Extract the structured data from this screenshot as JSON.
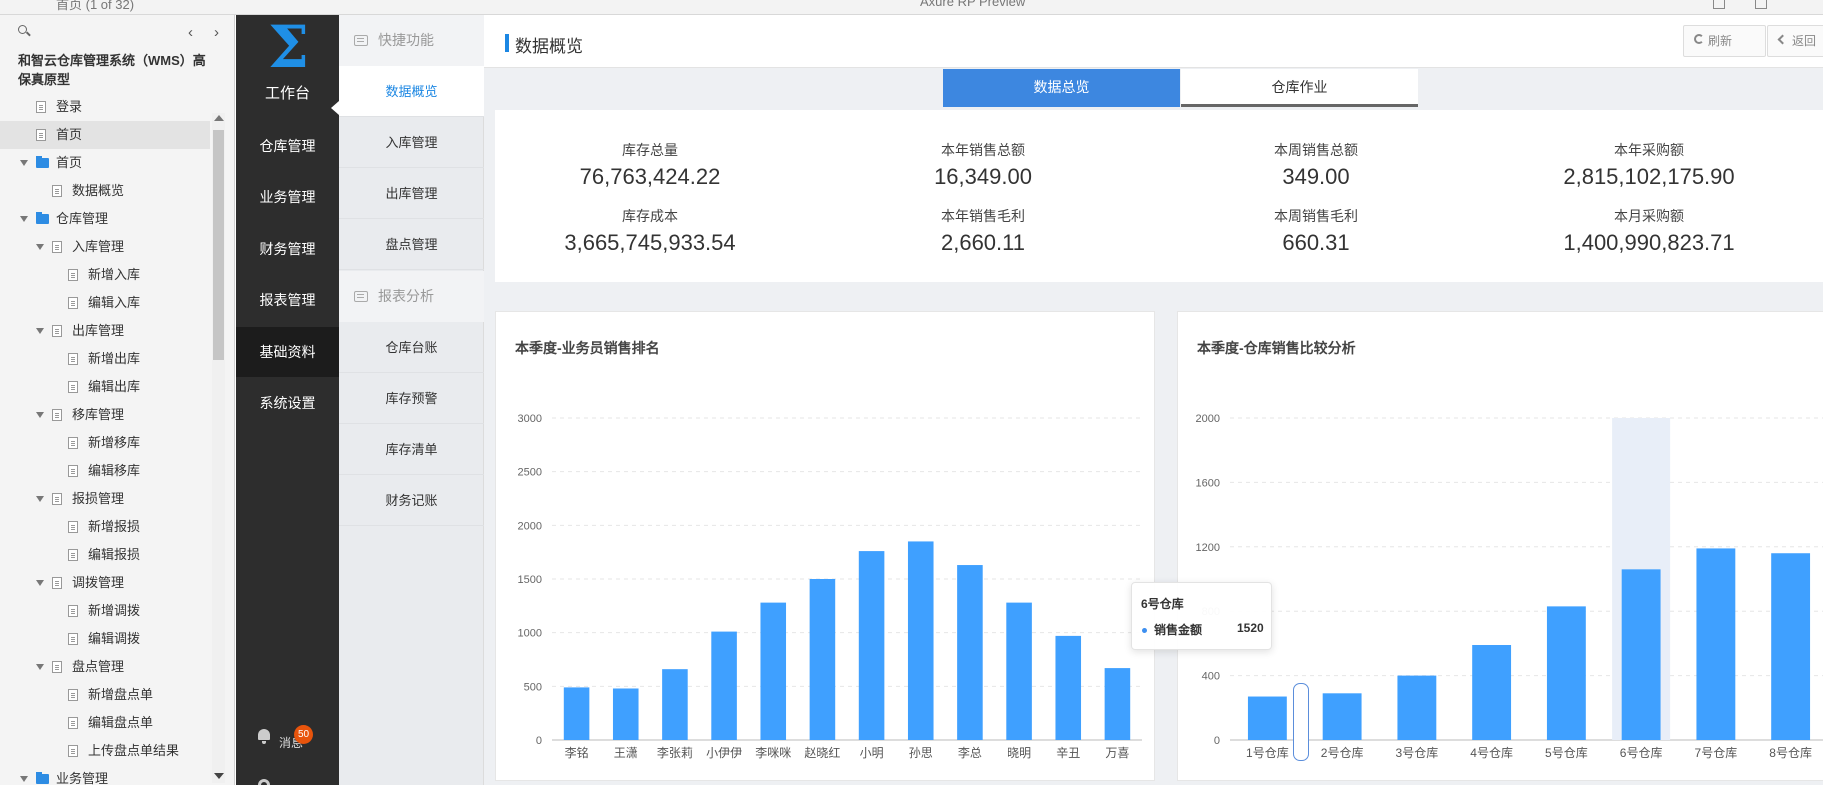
{
  "window": {
    "tab_title": "首页",
    "tab_suffix": "(1 of 32)",
    "center_title": "Axure RP Preview"
  },
  "tree": {
    "project_title": "和智云仓库管理系统（WMS）高保真原型",
    "items": [
      {
        "label": "登录",
        "level": 0,
        "type": "page"
      },
      {
        "label": "首页",
        "level": 0,
        "type": "page",
        "selected": true
      },
      {
        "label": "首页",
        "level": 0,
        "type": "folder"
      },
      {
        "label": "数据概览",
        "level": 1,
        "type": "page"
      },
      {
        "label": "仓库管理",
        "level": 0,
        "type": "folder"
      },
      {
        "label": "入库管理",
        "level": 1,
        "type": "pagegroup"
      },
      {
        "label": "新增入库",
        "level": 2,
        "type": "page"
      },
      {
        "label": "编辑入库",
        "level": 2,
        "type": "page"
      },
      {
        "label": "出库管理",
        "level": 1,
        "type": "pagegroup"
      },
      {
        "label": "新增出库",
        "level": 2,
        "type": "page"
      },
      {
        "label": "编辑出库",
        "level": 2,
        "type": "page"
      },
      {
        "label": "移库管理",
        "level": 1,
        "type": "pagegroup"
      },
      {
        "label": "新增移库",
        "level": 2,
        "type": "page"
      },
      {
        "label": "编辑移库",
        "level": 2,
        "type": "page"
      },
      {
        "label": "报损管理",
        "level": 1,
        "type": "pagegroup"
      },
      {
        "label": "新增报损",
        "level": 2,
        "type": "page"
      },
      {
        "label": "编辑报损",
        "level": 2,
        "type": "page"
      },
      {
        "label": "调拨管理",
        "level": 1,
        "type": "pagegroup"
      },
      {
        "label": "新增调拨",
        "level": 2,
        "type": "page"
      },
      {
        "label": "编辑调拨",
        "level": 2,
        "type": "page"
      },
      {
        "label": "盘点管理",
        "level": 1,
        "type": "pagegroup"
      },
      {
        "label": "新增盘点单",
        "level": 2,
        "type": "page"
      },
      {
        "label": "编辑盘点单",
        "level": 2,
        "type": "page"
      },
      {
        "label": "上传盘点单结果",
        "level": 2,
        "type": "page"
      },
      {
        "label": "业务管理",
        "level": 0,
        "type": "folder"
      }
    ]
  },
  "sidebar": {
    "logo": "Σ",
    "items": [
      {
        "label": "工作台",
        "active": false
      },
      {
        "label": "仓库管理",
        "active": false
      },
      {
        "label": "业务管理",
        "active": false
      },
      {
        "label": "财务管理",
        "active": false
      },
      {
        "label": "报表管理",
        "active": false
      },
      {
        "label": "基础资料",
        "active": true
      },
      {
        "label": "系统设置",
        "active": false
      }
    ],
    "notify_label": "消息",
    "notify_count": "50"
  },
  "submenu": {
    "group1": "快捷功能",
    "group2": "报表分析",
    "items1": [
      "数据概览",
      "入库管理",
      "出库管理",
      "盘点管理"
    ],
    "items2": [
      "仓库台账",
      "库存预警",
      "库存清单",
      "财务记账"
    ]
  },
  "header": {
    "title": "数据概览",
    "refresh": "刷新",
    "back": "返回"
  },
  "tabs": [
    "数据总览",
    "仓库作业"
  ],
  "stats": [
    {
      "label": "库存总量",
      "value": "76,763,424.22"
    },
    {
      "label": "本年销售总额",
      "value": "16,349.00"
    },
    {
      "label": "本周销售总额",
      "value": "349.00"
    },
    {
      "label": "本年采购额",
      "value": "2,815,102,175.90"
    },
    {
      "label": "库存成本",
      "value": "3,665,745,933.54"
    },
    {
      "label": "本年销售毛利",
      "value": "2,660.11"
    },
    {
      "label": "本周销售毛利",
      "value": "660.31"
    },
    {
      "label": "本月采购额",
      "value": "1,400,990,823.71"
    }
  ],
  "chart_data": [
    {
      "type": "bar",
      "title": "本季度-业务员销售排名",
      "categories": [
        "李铭",
        "王潇",
        "李张莉",
        "小伊伊",
        "李咪咪",
        "赵晓红",
        "小明",
        "孙思",
        "李总",
        "晓明",
        "辛丑",
        "万喜"
      ],
      "values": [
        490,
        480,
        660,
        1010,
        1280,
        1500,
        1760,
        1850,
        1630,
        1280,
        970,
        670
      ],
      "ylim": [
        0,
        3000
      ],
      "yticks": [
        0,
        500,
        1000,
        1500,
        2000,
        2500,
        3000
      ],
      "color": "#3fa0ff",
      "grid": true
    },
    {
      "type": "bar",
      "title": "本季度-仓库销售比较分析",
      "categories": [
        "1号仓库",
        "2号仓库",
        "3号仓库",
        "4号仓库",
        "5号仓库",
        "6号仓库",
        "7号仓库",
        "8号仓库"
      ],
      "values": [
        270,
        290,
        400,
        590,
        830,
        1060,
        1190,
        1160
      ],
      "ylim": [
        0,
        2000
      ],
      "yticks": [
        0,
        400,
        800,
        1200,
        1600,
        2000
      ],
      "color": "#3fa0ff",
      "grid": true,
      "highlighted_category": "6号仓库",
      "tooltip": {
        "title": "6号仓库",
        "series": "销售金额",
        "value": "1520"
      }
    }
  ]
}
